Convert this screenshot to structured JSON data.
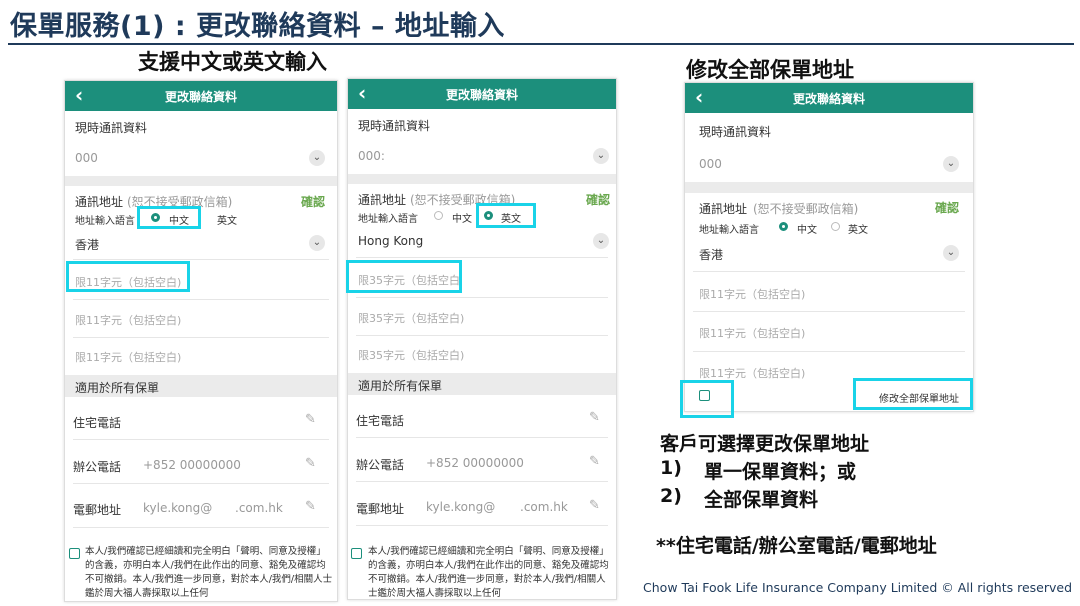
{
  "slide": {
    "title": "保單服務(1) : 更改聯絡資料 – 地址輸入",
    "caption_left": "支援中文或英文輸入",
    "caption_right": "修改全部保單地址",
    "note_heading": "客戶可選擇更改保單地址",
    "note_item1_num": "1)",
    "note_item1": "單一保單資料；或",
    "note_item2_num": "2)",
    "note_item2": "全部保單資料",
    "note_star": "**住宅電話/辦公室電話/電郵地址",
    "footer": "Chow Tai Fook Life Insurance Company Limited © All rights reserved"
  },
  "phone1": {
    "header_title": "更改聯絡資料",
    "current_label": "現時通訊資料",
    "current_value": "000",
    "address_label": "通訊地址",
    "address_hint": "(恕不接受郵政信箱)",
    "confirm": "確認",
    "lang_label": "地址輸入語言",
    "opt_zh": "中文",
    "opt_en": "英文",
    "region": "香港",
    "line1_placeholder": "限11字元（包括空白)",
    "line2_placeholder": "限11字元（包括空白)",
    "line3_placeholder": "限11字元（包括空白)",
    "section": "適用於所有保單",
    "home_phone": "住宅電話",
    "office_phone": "辦公電話",
    "office_value": "+852 00000000",
    "email_label": "電郵地址",
    "email_user": "kyle.kong@",
    "email_domain": ".com.hk",
    "disclaimer": "本人/我們確認已經細讀和完全明白「聲明、同意及授權」的含義，亦明白本人/我們在此作出的同意、豁免及確認均不可撤銷。本人/我們進一步同意，對於本人/我們/相關人士鑑於周大福人壽採取以上任何"
  },
  "phone2": {
    "header_title": "更改聯絡資料",
    "current_label": "現時通訊資料",
    "current_value": "000:",
    "address_label": "通訊地址",
    "address_hint": "(恕不接受郵政信箱)",
    "confirm": "確認",
    "lang_label": "地址輸入語言",
    "opt_zh": "中文",
    "opt_en": "英文",
    "region": "Hong Kong",
    "line1_placeholder": "限35字元（包括空白",
    "line2_placeholder": "限35字元（包括空白)",
    "line3_placeholder": "限35字元（包括空白)",
    "section": "適用於所有保單",
    "home_phone": "住宅電話",
    "office_phone": "辦公電話",
    "office_value": "+852 00000000",
    "email_label": "電郵地址",
    "email_user": "kyle.kong@",
    "email_domain": ".com.hk",
    "disclaimer": "本人/我們確認已經細讀和完全明白「聲明、同意及授權」的含義，亦明白本人/我們在此作出的同意、豁免及確認均不可撤銷。本人/我們進一步同意，對於本人/我們/相關人士鑑於周大福人壽採取以上任何"
  },
  "phone3": {
    "header_title": "更改聯絡資料",
    "current_label": "現時通訊資料",
    "current_value": "000",
    "address_label": "通訊地址",
    "address_hint": "(恕不接受郵政信箱)",
    "confirm": "確認",
    "lang_label": "地址輸入語言",
    "opt_zh": "中文",
    "opt_en": "英文",
    "region": "香港",
    "line1_placeholder": "限11字元（包括空白)",
    "line2_placeholder": "限11字元（包括空白)",
    "line3_placeholder": "限11字元（包括空白)",
    "apply_all": "修改全部保單地址"
  },
  "colors": {
    "appbar": "#1c8f7c",
    "highlight": "#19d3e8",
    "confirm": "#6aa84f",
    "title": "#1f3a5a"
  }
}
